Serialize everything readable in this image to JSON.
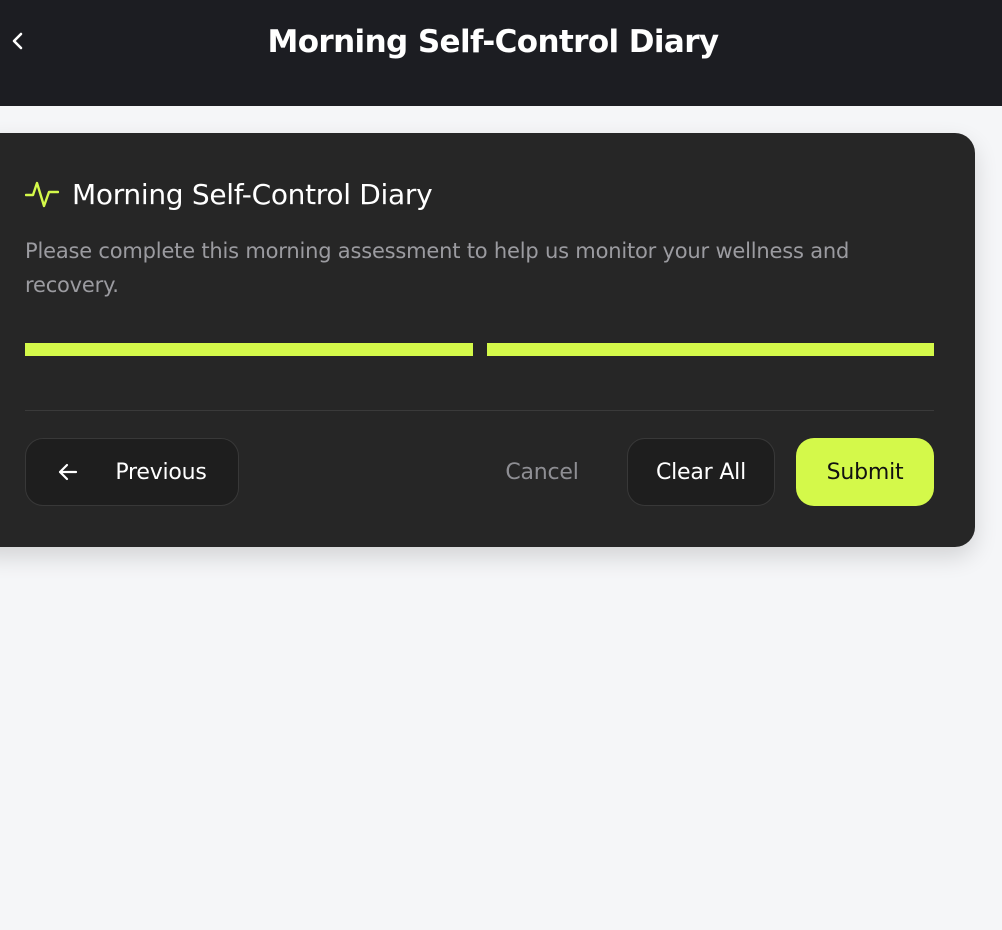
{
  "header": {
    "title": "Morning Self-Control Diary",
    "back_icon": "chevron-left-icon"
  },
  "card": {
    "icon": "pulse-icon",
    "title": "Morning Self-Control Diary",
    "description": "Please complete this morning assessment to help us monitor your wellness and recovery.",
    "progress": {
      "total_steps": 2,
      "completed_steps": 2
    }
  },
  "actions": {
    "previous_label": "Previous",
    "previous_icon": "arrow-left-icon",
    "cancel_label": "Cancel",
    "clear_label": "Clear All",
    "submit_label": "Submit"
  },
  "colors": {
    "accent": "#d4f94a",
    "topbar": "#1c1d22",
    "card": "#262626",
    "background": "#f5f6f8",
    "muted_text": "#9b9ba0"
  }
}
